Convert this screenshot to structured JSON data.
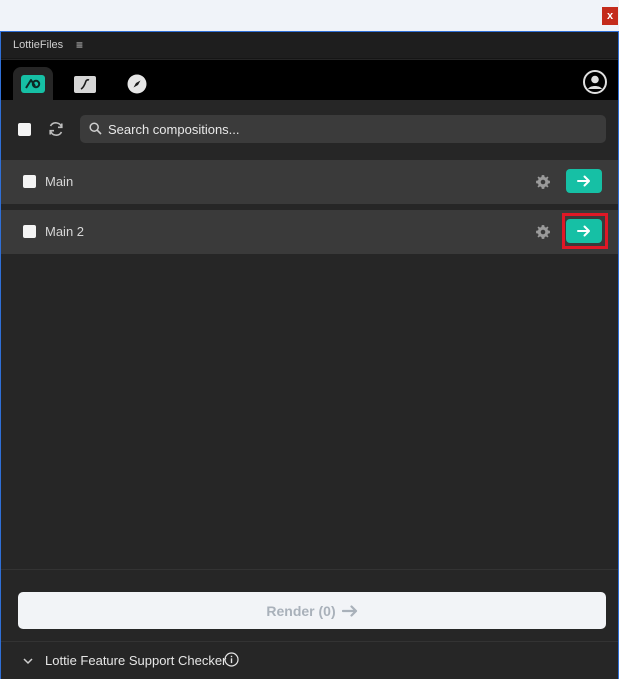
{
  "window": {
    "close_label": "x"
  },
  "panel": {
    "title": "LottieFiles",
    "menu_icon": "≡"
  },
  "tabs": [
    {
      "name": "lottie-icon",
      "active": true
    },
    {
      "name": "folder-icon",
      "active": false
    },
    {
      "name": "compass-icon",
      "active": false
    }
  ],
  "search": {
    "placeholder": "Search compositions..."
  },
  "compositions": [
    {
      "label": "Main"
    },
    {
      "label": "Main 2"
    }
  ],
  "render": {
    "label": "Render (0)"
  },
  "feature_checker": {
    "label": "Lottie Feature Support Checker"
  },
  "colors": {
    "accent": "#16c0a5",
    "highlight": "#e01826",
    "panel_bg": "#262626",
    "row_bg": "#3a3a3a"
  }
}
